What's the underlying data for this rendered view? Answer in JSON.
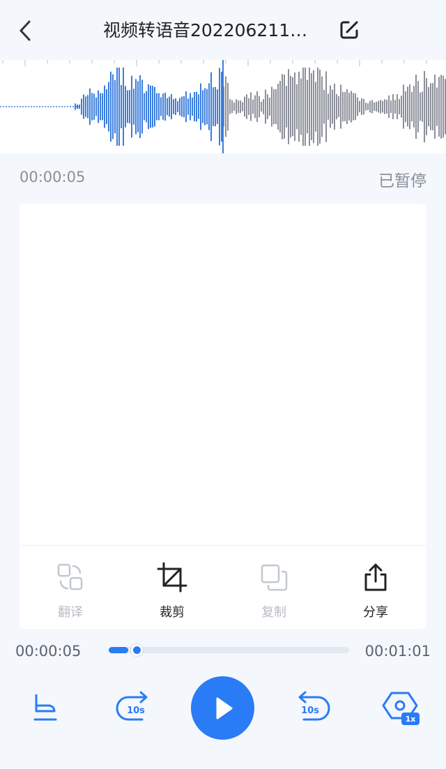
{
  "header": {
    "title": "视频转语音202206211…",
    "back_icon": "chevron-left-icon",
    "edit_icon": "edit-icon"
  },
  "waveform": {
    "played_color": "#3b7ddd",
    "unplayed_color": "#8b8f99",
    "playhead_color": "#3b7ddd"
  },
  "playback_info": {
    "current_time": "00:00:05",
    "status": "已暂停"
  },
  "toolbar": {
    "items": [
      {
        "label": "翻译",
        "icon": "translate-icon",
        "enabled": false
      },
      {
        "label": "裁剪",
        "icon": "crop-icon",
        "enabled": true
      },
      {
        "label": "复制",
        "icon": "copy-icon",
        "enabled": false
      },
      {
        "label": "分享",
        "icon": "share-icon",
        "enabled": true
      }
    ]
  },
  "progress": {
    "start": "00:00:05",
    "end": "00:01:01",
    "fraction": 0.082
  },
  "controls": {
    "mark_icon": "flag-marker-icon",
    "rewind_label": "10s",
    "forward_label": "10s",
    "speed_label": "1x",
    "accent_color": "#2a7bf6"
  }
}
